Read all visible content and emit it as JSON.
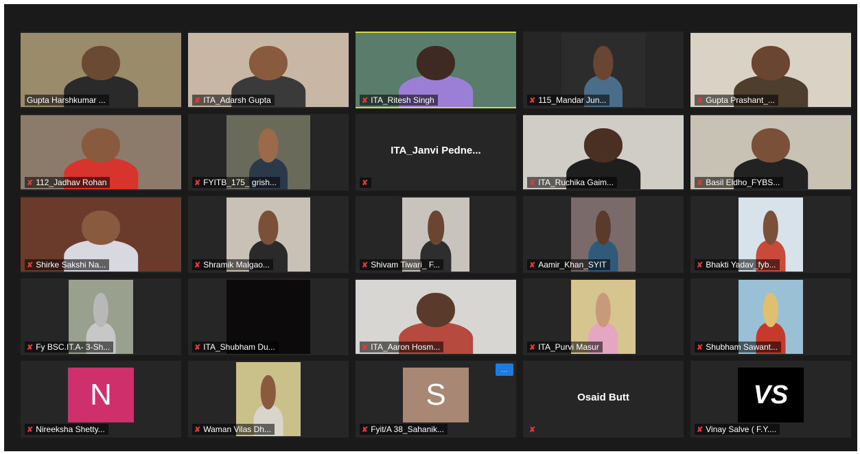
{
  "meeting": {
    "participants": [
      {
        "name": "Gupta Harshkumar ...",
        "mic_muted": false,
        "bg": "#9a8b6a",
        "skin": "#6b4a34",
        "shirt": "#2a2a2a",
        "layout": "full"
      },
      {
        "name": "ITA_Adarsh Gupta",
        "mic_muted": true,
        "bg": "#c9b7a6",
        "skin": "#8a5a3e",
        "shirt": "#3a3a3a",
        "layout": "full"
      },
      {
        "name": "ITA_Ritesh Singh",
        "mic_muted": true,
        "bg": "#5a7c6a",
        "skin": "#3e2a22",
        "shirt": "#9b7fd6",
        "layout": "full",
        "active": true
      },
      {
        "name": "115_Mandar Jun...",
        "mic_muted": true,
        "bg": "#2c2c2c",
        "skin": "#6a4632",
        "shirt": "#4a6e8a",
        "layout": "center"
      },
      {
        "name": "Gupta Prashant_...",
        "mic_muted": true,
        "bg": "#d9d2c5",
        "skin": "#6a4632",
        "shirt": "#4e3e2e",
        "layout": "full"
      },
      {
        "name": "112_Jadhav Rohan",
        "mic_muted": true,
        "bg": "#8c7a6a",
        "skin": "#8a5a3e",
        "shirt": "#d6342c",
        "layout": "full"
      },
      {
        "name": "FYITB_175_ grish...",
        "mic_muted": true,
        "bg": "#6a6a5a",
        "skin": "#9a6a4a",
        "shirt": "#2a3a4a",
        "layout": "center"
      },
      {
        "name": "ITA_Janvi  Pedne...",
        "mic_muted": true,
        "video": false
      },
      {
        "name": "ITA_Ruchika Gaim...",
        "mic_muted": true,
        "bg": "#d0ccc6",
        "skin": "#4a3022",
        "shirt": "#1e1e1e",
        "layout": "full"
      },
      {
        "name": "Basil Eldho_FYBS...",
        "mic_muted": true,
        "bg": "#c8c2b4",
        "skin": "#7a5038",
        "shirt": "#222222",
        "layout": "full"
      },
      {
        "name": "Shirke Sakshi Na...",
        "mic_muted": true,
        "bg": "#6a3a2a",
        "skin": "#8a5a3e",
        "shirt": "#d8d8e0",
        "layout": "full"
      },
      {
        "name": "Shramik Malgao...",
        "mic_muted": true,
        "bg": "#c9c1b5",
        "skin": "#7a5038",
        "shirt": "#2a2a2a",
        "layout": "center"
      },
      {
        "name": "Shivam Tiwari_ F...",
        "mic_muted": true,
        "bg": "#c8c3bd",
        "skin": "#6a4632",
        "shirt": "#2e2e2e",
        "layout": "centerwide"
      },
      {
        "name": "Aamir_Khan_SYIT",
        "mic_muted": true,
        "bg": "#7a6a6a",
        "skin": "#5a3a2a",
        "shirt": "#2f5a7a",
        "layout": "small"
      },
      {
        "name": "Bhakti Yadav_fyb...",
        "mic_muted": true,
        "bg": "#d8e2ea",
        "skin": "#7a5038",
        "shirt": "#c94a3a",
        "layout": "small"
      },
      {
        "name": "Fy BSC.IT.A- 3-Sh...",
        "mic_muted": true,
        "bg": "#9aa08e",
        "skin": "#b8b8b8",
        "shirt": "#c7c7c7",
        "layout": "small"
      },
      {
        "name": "ITA_Shubham Du...",
        "mic_muted": true,
        "bg": "#0d0a0c",
        "skin": "#0d0a0c",
        "shirt": "#0d0a0c",
        "layout": "center"
      },
      {
        "name": "ITA_Aaron Hosm...",
        "mic_muted": true,
        "bg": "#d8d6d2",
        "skin": "#5a3a2a",
        "shirt": "#b64a3e",
        "layout": "full"
      },
      {
        "name": "ITA_Purvi Masur",
        "mic_muted": true,
        "bg": "#d6c58e",
        "skin": "#c89a7a",
        "shirt": "#e4a6c0",
        "layout": "small"
      },
      {
        "name": "Shubham Sawant...",
        "mic_muted": true,
        "bg": "#9ac0d6",
        "skin": "#e0c070",
        "shirt": "#c63a2e",
        "layout": "small"
      },
      {
        "name": "Nireeksha Shetty...",
        "mic_muted": true,
        "avatar": "N",
        "avatar_color": "#cf2f6b"
      },
      {
        "name": "Waman Vilas Dh...",
        "mic_muted": true,
        "bg": "#c9c08a",
        "skin": "#8a5a3e",
        "shirt": "#d9d4cc",
        "layout": "small"
      },
      {
        "name": "Fyit/A 38_Sahanik...",
        "mic_muted": true,
        "avatar": "S",
        "avatar_color": "#a88774",
        "more": "…"
      },
      {
        "name": "Osaid Butt",
        "mic_muted": true,
        "video": false,
        "nametag": false
      },
      {
        "name": "Vinay Salve ( F.Y....",
        "mic_muted": true,
        "avatar": "VS",
        "avatar_color": "#000000"
      }
    ]
  }
}
